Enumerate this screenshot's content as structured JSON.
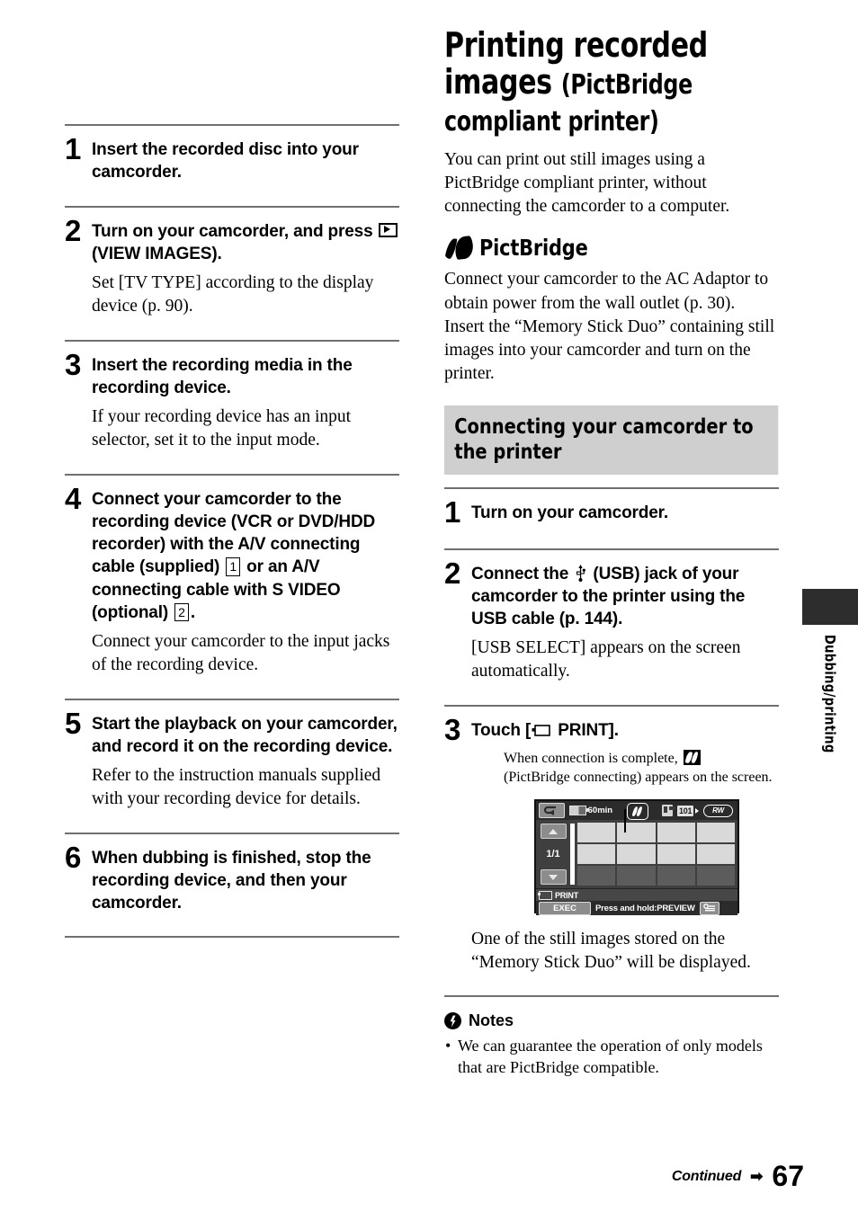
{
  "page": {
    "number": "67",
    "continued_label": "Continued",
    "continued_arrow": "➡",
    "side_tab_label": "Dubbing/printing"
  },
  "left_column": {
    "steps": [
      {
        "num": "1",
        "head_pre": "Insert the recorded disc into your camcorder.",
        "note": ""
      },
      {
        "num": "2",
        "head_pre": "Turn on your camcorder, and press ",
        "head_post": "(VIEW IMAGES).",
        "note": "Set [TV TYPE] according to the display device (p. 90)."
      },
      {
        "num": "3",
        "head_pre": "Insert the recording media in the recording device.",
        "note": "If your recording device has an input selector, set it to the input mode."
      },
      {
        "num": "4",
        "head_pre": "Connect your camcorder to the recording device (VCR or DVD/HDD recorder) with the A/V connecting cable (supplied) ",
        "box1": "1",
        "head_mid": " or an A/V connecting cable with S VIDEO (optional) ",
        "box2": "2",
        "head_post": ".",
        "note": "Connect your camcorder to the input jacks of the recording device."
      },
      {
        "num": "5",
        "head_pre": "Start the playback on your camcorder, and record it on the recording device.",
        "note": "Refer to the instruction manuals supplied with your recording device for details."
      },
      {
        "num": "6",
        "head_pre": "When dubbing is finished, stop the recording device, and then your camcorder.",
        "note": ""
      }
    ]
  },
  "right_column": {
    "title_line1": "Printing recorded",
    "title_line2": "images",
    "title_sub": "(PictBridge compliant printer)",
    "intro": "You can print out still images using a PictBridge compliant printer, without connecting the camcorder to a computer.",
    "pictbridge_wordmark": "PictBridge",
    "pictbridge_para": "Connect your camcorder to the AC Adaptor to obtain power from the wall outlet (p. 30). Insert the “Memory Stick Duo” containing still images into your camcorder and turn on the printer.",
    "section_header": "Connecting your camcorder to the printer",
    "steps": [
      {
        "num": "1",
        "head_pre": "Turn on your camcorder.",
        "note": ""
      },
      {
        "num": "2",
        "head_pre": "Connect the ",
        "head_post": " (USB) jack of your camcorder to the printer using the USB cable (p. 144).",
        "note": "[USB SELECT] appears on the screen automatically."
      },
      {
        "num": "3",
        "head_pre": "Touch [",
        "head_post": " PRINT].",
        "note": ""
      }
    ],
    "lcd_caption_pre": "When connection is complete, ",
    "lcd_caption_post": "(PictBridge connecting) appears on the screen.",
    "after_lcd": "One of the still images stored on the “Memory Stick Duo” will be displayed.",
    "notes_title": "Notes",
    "notes": [
      "We can guarantee the operation of only models that are PictBridge compatible."
    ]
  },
  "lcd_screen": {
    "battery_time": "60min",
    "folder_number": "101",
    "disc_label": "RW",
    "page_indicator": "1/1",
    "print_label": "PRINT",
    "exec_label": "EXEC",
    "hold_label": "Press and hold:PREVIEW"
  }
}
